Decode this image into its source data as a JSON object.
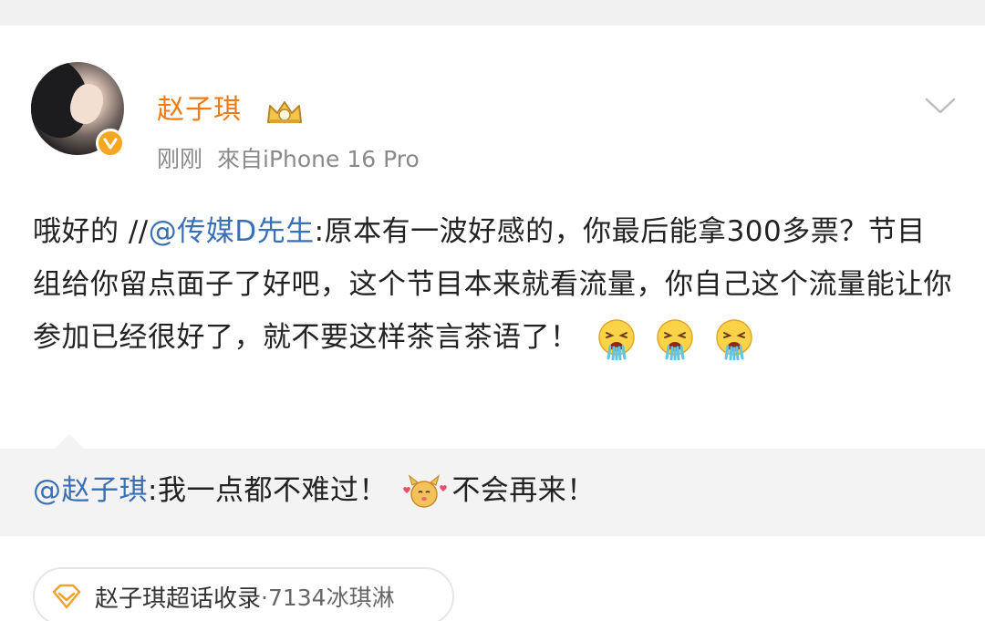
{
  "post": {
    "author_name": "赵子琪",
    "timestamp": "刚刚",
    "source": "來自iPhone 16 Pro",
    "content": {
      "prefix": "哦好的 //",
      "mention": "@传媒D先生",
      "text": ":原本有一波好感的，你最后能拿300多票？节目组给你留点面子了好吧，这个节目本来就看流量，你自己这个流量能让你参加已经很好了，就不要这样茶言茶语了！",
      "emoji_name": "vomit-emoji"
    }
  },
  "repost": {
    "mention": "@赵子琪",
    "text_before": ":我一点都不难过！",
    "sticker_name": "cute-dog-sticker",
    "text_after": "不会再来！"
  },
  "topic_tag": {
    "label": "赵子琪超话收录",
    "count": "·7134冰琪淋",
    "icon": "diamond-icon"
  },
  "colors": {
    "name": "#ef7b12",
    "mention": "#3b6fb4",
    "verify_badge": "#f5a623",
    "repost_bg": "#f3f3f3"
  }
}
